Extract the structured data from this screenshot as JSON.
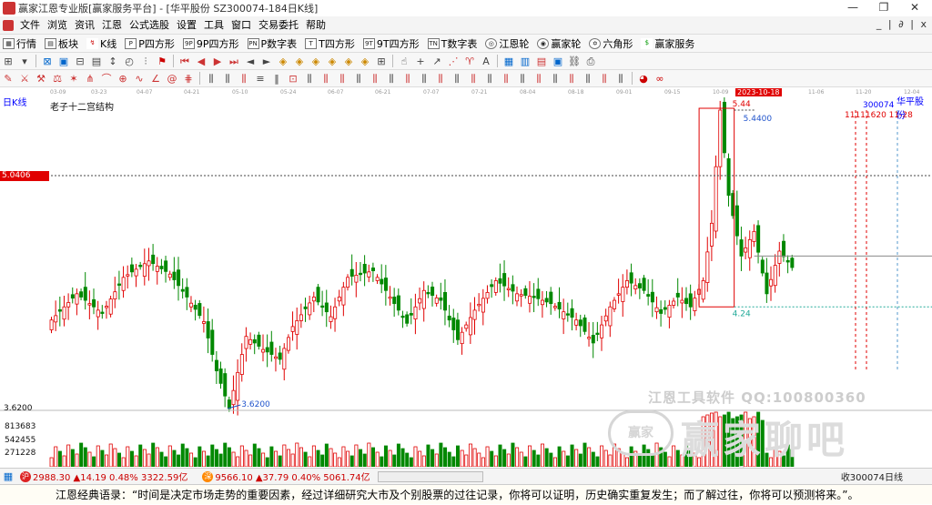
{
  "window": {
    "title": "赢家江恩专业版[赢家服务平台] - [华平股份  SZ300074-184日K线]"
  },
  "menu": {
    "items": [
      "文件",
      "浏览",
      "资讯",
      "江恩",
      "公式选股",
      "设置",
      "工具",
      "窗口",
      "交易委托",
      "帮助"
    ],
    "sub_controls": "_ | ∂ | x"
  },
  "toolbar1": {
    "items": [
      {
        "label": "行情",
        "icon": "grid-icon"
      },
      {
        "label": "板块",
        "icon": "blocks-icon"
      },
      {
        "label": "K线",
        "icon": "kline-icon"
      },
      {
        "label": "P四方形",
        "icon": "p-square-icon"
      },
      {
        "label": "9P四方形",
        "icon": "9p-square-icon"
      },
      {
        "label": "P数字表",
        "icon": "p-table-icon"
      },
      {
        "label": "T四方形",
        "icon": "t-square-icon"
      },
      {
        "label": "9T四方形",
        "icon": "9t-square-icon"
      },
      {
        "label": "T数字表",
        "icon": "t-table-icon"
      },
      {
        "label": "江恩轮",
        "icon": "gann-wheel-icon"
      },
      {
        "label": "赢家轮",
        "icon": "winner-wheel-icon"
      },
      {
        "label": "六角形",
        "icon": "hexagon-icon"
      },
      {
        "label": "赢家服务",
        "icon": "dollar-icon"
      }
    ]
  },
  "chart_header": {
    "mode_label": "日K线",
    "study_title": "老子十二宫结构",
    "stock_code": "300074",
    "stock_name": "华平股份",
    "date_labels": [
      "03-09",
      "03-23",
      "04-07",
      "04-21",
      "05-10",
      "05-24",
      "06-07",
      "06-21",
      "07-07",
      "07-21",
      "08-04",
      "08-18",
      "09-01",
      "09-15",
      "10-09",
      "2023-10-18",
      "11-06",
      "11-20",
      "12-04"
    ],
    "highlight_date": "2023-10-18"
  },
  "price_labels": {
    "high_marker": "5.44",
    "high_value": "5.4400",
    "low_marker": "3.6200",
    "low_axis": "3.6200",
    "box_low": "4.24",
    "left_price": "5.0406",
    "right_dates": "11111620  11-28"
  },
  "volume_labels": [
    "813683",
    "542455",
    "271228"
  ],
  "watermark": {
    "tools": "江恩工具软件   QQ:100800360",
    "logo_text": "赢家",
    "brand": "赢家聊吧",
    "site": "iaoba.ye3.."
  },
  "status_bar": {
    "index1": "2988.30 ▲14.19 0.48% 3322.59亿",
    "index2": "9566.10 ▲37.79 0.40% 5061.74亿",
    "right_text": "收300074日线"
  },
  "footer_quote": "江恩经典语录：“时间是决定市场走势的重要因素，经过详细研究大市及个别股票的过往记录，你将可以证明，历史确实重复发生；而了解过往，你将可以预测将来。”。",
  "colors": {
    "up": "#e00000",
    "down": "#008800",
    "blue": "#2255cc",
    "redbox": "#e00000"
  },
  "chart_data": {
    "type": "candlestick",
    "title": "老子十二宫结构",
    "price_range": [
      3.62,
      5.44
    ],
    "highlight_level": 5.0406,
    "annotations": [
      {
        "label": "5.44",
        "kind": "high"
      },
      {
        "label": "5.4400",
        "kind": "high"
      },
      {
        "label": "3.6200",
        "kind": "low"
      },
      {
        "label": "4.24",
        "kind": "box-low"
      }
    ],
    "volume_ticks": [
      813683,
      542455,
      271228
    ]
  }
}
